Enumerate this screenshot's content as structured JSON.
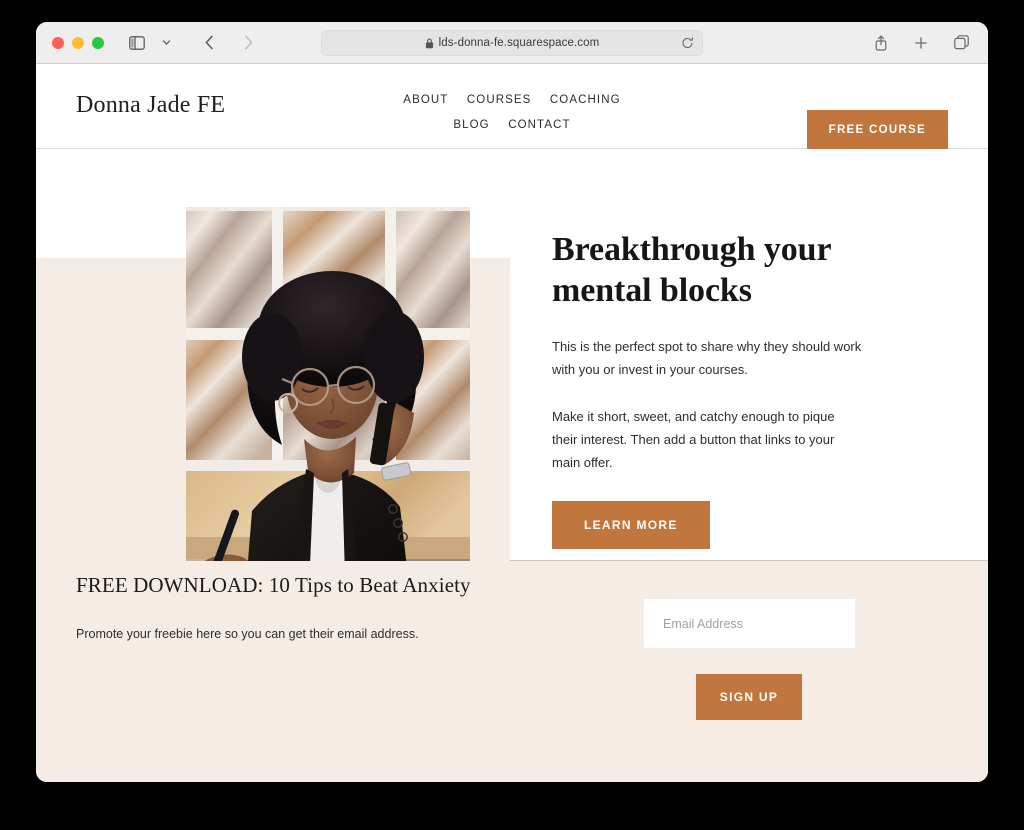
{
  "browser": {
    "url": "lds-donna-fe.squarespace.com",
    "lock_icon": "lock-icon",
    "reload_icon": "reload-icon",
    "sidebar_icon": "sidebar-toggle-icon",
    "tab_group_icon": "chevron-down-icon",
    "back_icon": "back-chevron-icon",
    "forward_icon": "forward-chevron-icon",
    "share_icon": "share-icon",
    "new_tab_icon": "plus-icon",
    "tab_overview_icon": "tab-overview-icon"
  },
  "site": {
    "logo": "Donna Jade FE",
    "nav": [
      {
        "label": "ABOUT"
      },
      {
        "label": "COURSES"
      },
      {
        "label": "COACHING"
      },
      {
        "label": "BLOG"
      },
      {
        "label": "CONTACT"
      }
    ],
    "cta_button": "FREE COURSE"
  },
  "hero": {
    "heading_line1": "Breakthrough your",
    "heading_line2": "mental blocks",
    "paragraph1": "This is the perfect spot to share why they should work with you or invest in your courses.",
    "paragraph2": "Make it short, sweet, and catchy enough to pique their interest. Then add a button that links to your main offer.",
    "button": "LEARN MORE",
    "image_alt": "woman-on-phone-writing-photo"
  },
  "optin": {
    "heading": "FREE DOWNLOAD: 10 Tips to Beat Anxiety",
    "subtext": "Promote your freebie here so you can get their email address.",
    "email_placeholder": "Email Address",
    "email_value": "",
    "button": "SIGN UP"
  },
  "colors": {
    "accent": "#c0763c",
    "beige": "#f6ece6",
    "text": "#1f1f1f"
  }
}
